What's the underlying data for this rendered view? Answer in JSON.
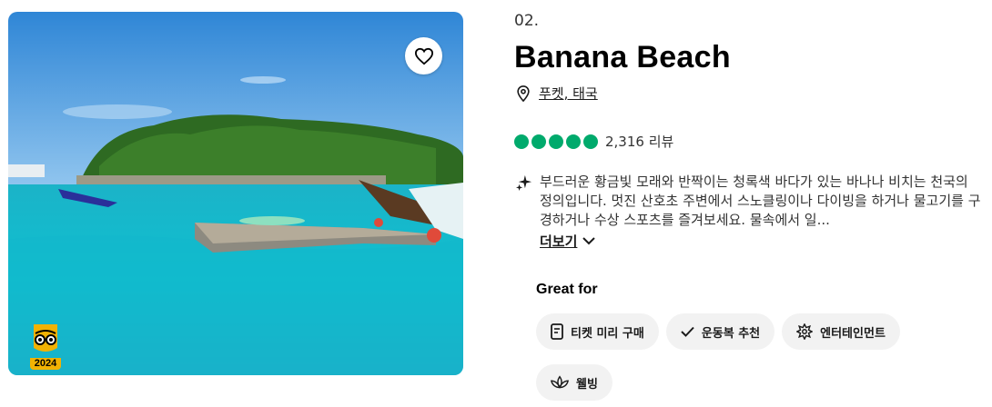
{
  "photo": {
    "alt": "Banana Beach",
    "award_year": "2024",
    "heart_icon": "heart-outline-icon",
    "award_icon": "travellers-choice-award-icon"
  },
  "attraction": {
    "rank": "02.",
    "title": "Banana Beach",
    "location": "푸켓, 태국",
    "rating_value": 5,
    "review_count": "2,316 리뷰",
    "description": "부드러운 황금빛 모래와 반짝이는 청록색 바다가 있는 바나나 비치는 천국의 정의입니다. 멋진 산호초 주변에서 스노클링이나 다이빙을 하거나 물고기를 구경하거나 수상 스포츠를 즐겨보세요. 물속에서 일...",
    "more_label": "더보기"
  },
  "great_for": {
    "heading": "Great for",
    "chips": [
      {
        "label": "티켓 미리 구매",
        "icon": "ticket-icon"
      },
      {
        "label": "운동복 추천",
        "icon": "check-icon"
      },
      {
        "label": "엔터테인먼트",
        "icon": "entertainment-icon"
      },
      {
        "label": "웰빙",
        "icon": "lotus-icon"
      }
    ]
  },
  "colors": {
    "rating_green": "#00aa6c",
    "chip_bg": "#f2f2f2",
    "award_gold": "#f2b203"
  }
}
